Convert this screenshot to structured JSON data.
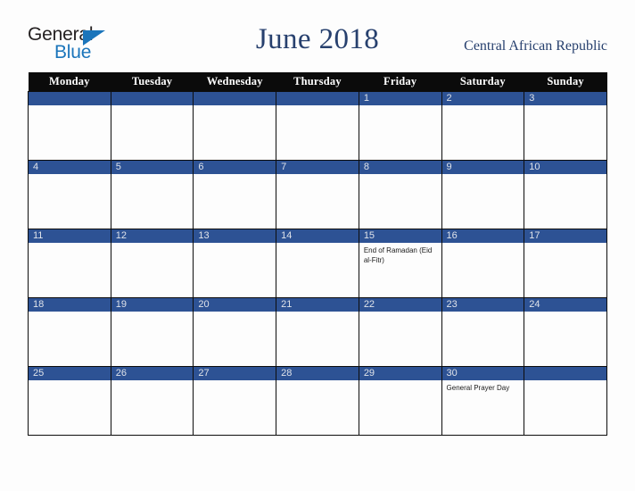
{
  "brand": {
    "word_one": "General",
    "word_two": "Blue",
    "triangle_icon": "triangle-right-icon",
    "accent_color": "#1b75bb",
    "text_color": "#231f20"
  },
  "header": {
    "title": "June 2018",
    "country": "Central African Republic",
    "title_color": "#27406e"
  },
  "calendar": {
    "weekday_headers": [
      "Monday",
      "Tuesday",
      "Wednesday",
      "Thursday",
      "Friday",
      "Saturday",
      "Sunday"
    ],
    "header_bg": "#0b0b0b",
    "day_band_color": "#2d5294",
    "day_number_color": "#dfe3ea",
    "cell_bg": "#fdfdfd",
    "weeks": [
      [
        {
          "day": "",
          "events": []
        },
        {
          "day": "",
          "events": []
        },
        {
          "day": "",
          "events": []
        },
        {
          "day": "",
          "events": []
        },
        {
          "day": "1",
          "events": []
        },
        {
          "day": "2",
          "events": []
        },
        {
          "day": "3",
          "events": []
        }
      ],
      [
        {
          "day": "4",
          "events": []
        },
        {
          "day": "5",
          "events": []
        },
        {
          "day": "6",
          "events": []
        },
        {
          "day": "7",
          "events": []
        },
        {
          "day": "8",
          "events": []
        },
        {
          "day": "9",
          "events": []
        },
        {
          "day": "10",
          "events": []
        }
      ],
      [
        {
          "day": "11",
          "events": []
        },
        {
          "day": "12",
          "events": []
        },
        {
          "day": "13",
          "events": []
        },
        {
          "day": "14",
          "events": []
        },
        {
          "day": "15",
          "events": [
            "End of Ramadan (Eid al-Fitr)"
          ]
        },
        {
          "day": "16",
          "events": []
        },
        {
          "day": "17",
          "events": []
        }
      ],
      [
        {
          "day": "18",
          "events": []
        },
        {
          "day": "19",
          "events": []
        },
        {
          "day": "20",
          "events": []
        },
        {
          "day": "21",
          "events": []
        },
        {
          "day": "22",
          "events": []
        },
        {
          "day": "23",
          "events": []
        },
        {
          "day": "24",
          "events": []
        }
      ],
      [
        {
          "day": "25",
          "events": []
        },
        {
          "day": "26",
          "events": []
        },
        {
          "day": "27",
          "events": []
        },
        {
          "day": "28",
          "events": []
        },
        {
          "day": "29",
          "events": []
        },
        {
          "day": "30",
          "events": [
            "General Prayer Day"
          ]
        },
        {
          "day": "",
          "events": []
        }
      ]
    ]
  }
}
